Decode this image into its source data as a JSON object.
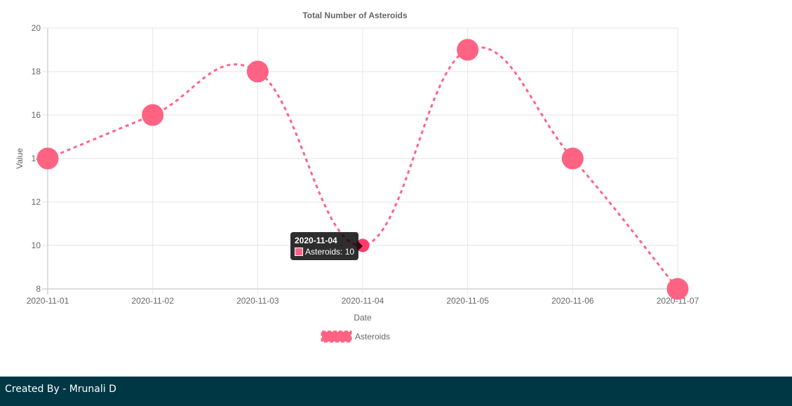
{
  "chart_data": {
    "type": "line",
    "title": "Total Number of Asteroids",
    "xlabel": "Date",
    "ylabel": "Value",
    "categories": [
      "2020-11-01",
      "2020-11-02",
      "2020-11-03",
      "2020-11-04",
      "2020-11-05",
      "2020-11-06",
      "2020-11-07"
    ],
    "series": [
      {
        "name": "Asteroids",
        "values": [
          14,
          16,
          18,
          10,
          19,
          14,
          8
        ],
        "color": "#ff6384",
        "line_style": "dashed",
        "smooth": true
      }
    ],
    "ylim": [
      8,
      20
    ],
    "yticks": [
      8,
      10,
      12,
      14,
      16,
      18,
      20
    ],
    "grid": true,
    "legend": "bottom",
    "tooltip": {
      "title": "2020-11-04",
      "label": "Asteroids: 10",
      "active_index": 3
    }
  },
  "footer": {
    "text": "Created By - Mrunali D"
  }
}
